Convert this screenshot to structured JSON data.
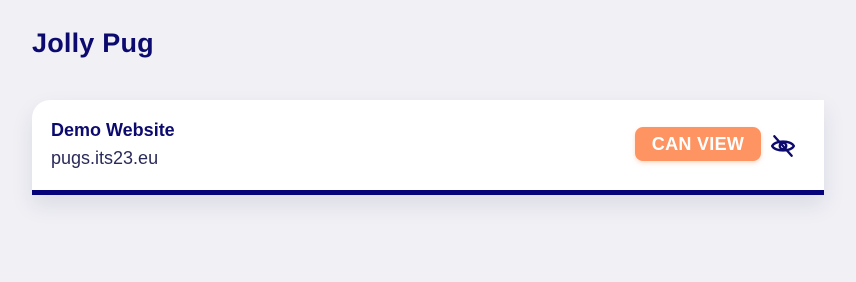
{
  "header": {
    "title": "Jolly Pug"
  },
  "site": {
    "name": "Demo Website",
    "url": "pugs.its23.eu",
    "permission_label": "CAN VIEW",
    "visibility_icon": "eye-off-icon"
  },
  "colors": {
    "primary": "#0c0a6e",
    "accent": "#fd9462",
    "background": "#f0f0f5",
    "card_border": "#07047a"
  }
}
